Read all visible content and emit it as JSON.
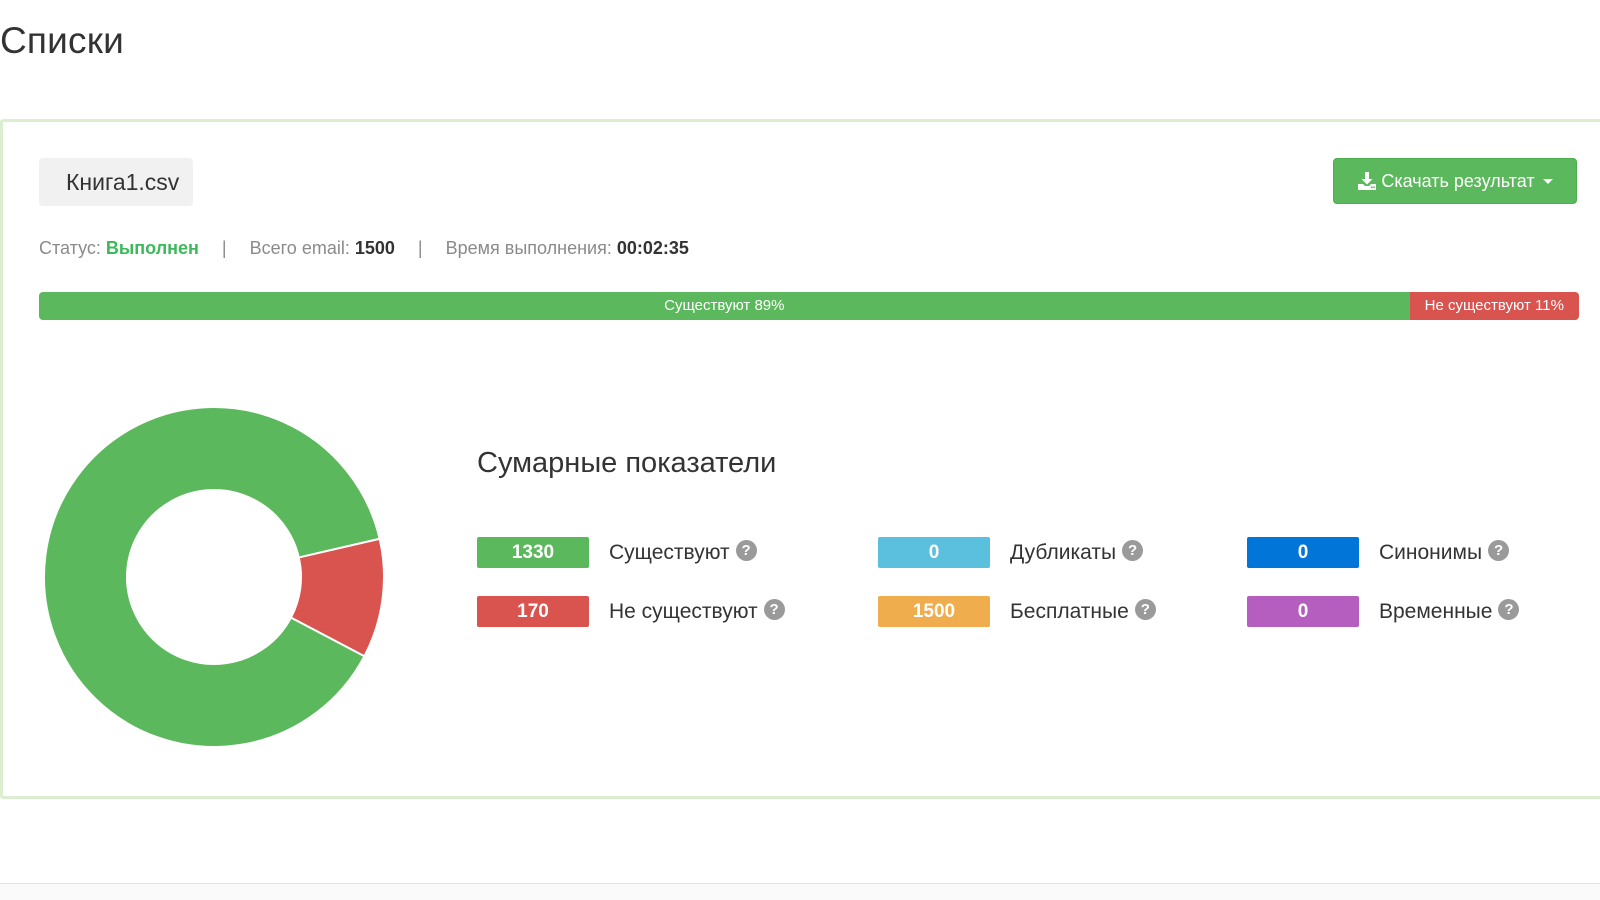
{
  "page": {
    "title": "Списки"
  },
  "file": {
    "name": "Книга1.csv"
  },
  "download": {
    "label": "Скачать результат"
  },
  "status": {
    "status_label": "Статус:",
    "status_value": "Выполнен",
    "total_label": "Всего email:",
    "total_value": "1500",
    "time_label": "Время выполнения:",
    "time_value": "00:02:35",
    "separator": "|"
  },
  "progress": {
    "segments": [
      {
        "label": "Существуют 89%",
        "percent": 89,
        "color": "#5cb85c"
      },
      {
        "label": "Не существуют 11%",
        "percent": 11,
        "color": "#d9534f"
      }
    ]
  },
  "summary": {
    "title": "Сумарные показатели",
    "help_glyph": "?",
    "stats": [
      {
        "value": "1330",
        "label": "Существуют",
        "color": "#5cb85c"
      },
      {
        "value": "170",
        "label": "Не существуют",
        "color": "#d9534f"
      },
      {
        "value": "0",
        "label": "Дубликаты",
        "color": "#5bc0de"
      },
      {
        "value": "1500",
        "label": "Бесплатные",
        "color": "#f0ad4e"
      },
      {
        "value": "0",
        "label": "Синонимы",
        "color": "#0275d8"
      },
      {
        "value": "0",
        "label": "Временные",
        "color": "#b55ec0"
      }
    ]
  },
  "chart_data": {
    "type": "pie",
    "categories": [
      "Существуют",
      "Не существуют"
    ],
    "values": [
      1330,
      170
    ],
    "colors": [
      "#5cb85c",
      "#d9534f"
    ]
  }
}
